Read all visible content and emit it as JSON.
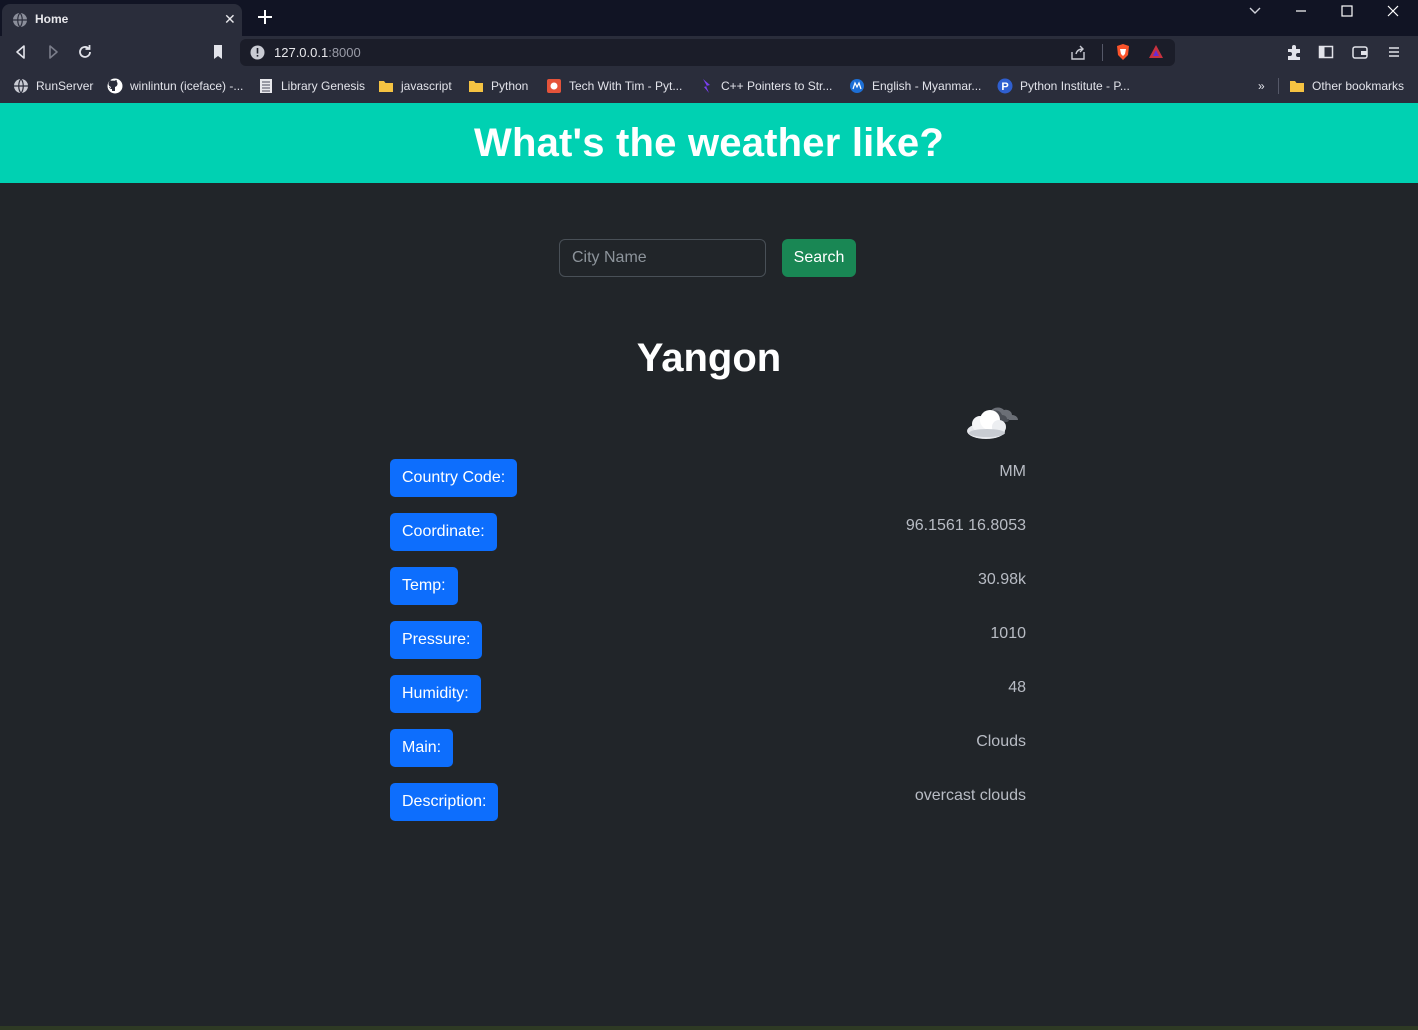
{
  "browser": {
    "tab_title": "Home",
    "url_host": "127.0.0.1",
    "url_port": ":8000",
    "bookmarks": [
      {
        "label": "RunServer",
        "icon": "globe-icon"
      },
      {
        "label": "winlintun (iceface) -...",
        "icon": "github-icon"
      },
      {
        "label": "Library Genesis",
        "icon": "book-icon"
      },
      {
        "label": "javascript",
        "icon": "folder-icon"
      },
      {
        "label": "Python",
        "icon": "folder-icon"
      },
      {
        "label": "Tech With Tim - Pyt...",
        "icon": "site-icon"
      },
      {
        "label": "C++ Pointers to Str...",
        "icon": "site-icon"
      },
      {
        "label": "English - Myanmar...",
        "icon": "site-icon"
      },
      {
        "label": "Python Institute - P...",
        "icon": "site-icon"
      }
    ],
    "overflow_label": "»",
    "other_bookmarks": "Other bookmarks"
  },
  "page": {
    "title": "What's the weather like?",
    "search": {
      "placeholder": "City Name",
      "value": "",
      "button": "Search"
    },
    "city": "Yangon",
    "weather_icon": "cloud-icon",
    "rows": [
      {
        "label": "Country Code:",
        "value": "MM"
      },
      {
        "label": "Coordinate:",
        "value": "96.1561 16.8053"
      },
      {
        "label": "Temp:",
        "value": "30.98k"
      },
      {
        "label": "Pressure:",
        "value": "1010"
      },
      {
        "label": "Humidity:",
        "value": "48"
      },
      {
        "label": "Main:",
        "value": "Clouds"
      },
      {
        "label": "Description:",
        "value": "overcast clouds"
      }
    ]
  },
  "colors": {
    "hero": "#00d1b2",
    "page_bg": "#212529",
    "label_bg": "#0d6efd",
    "search_btn": "#198754"
  }
}
